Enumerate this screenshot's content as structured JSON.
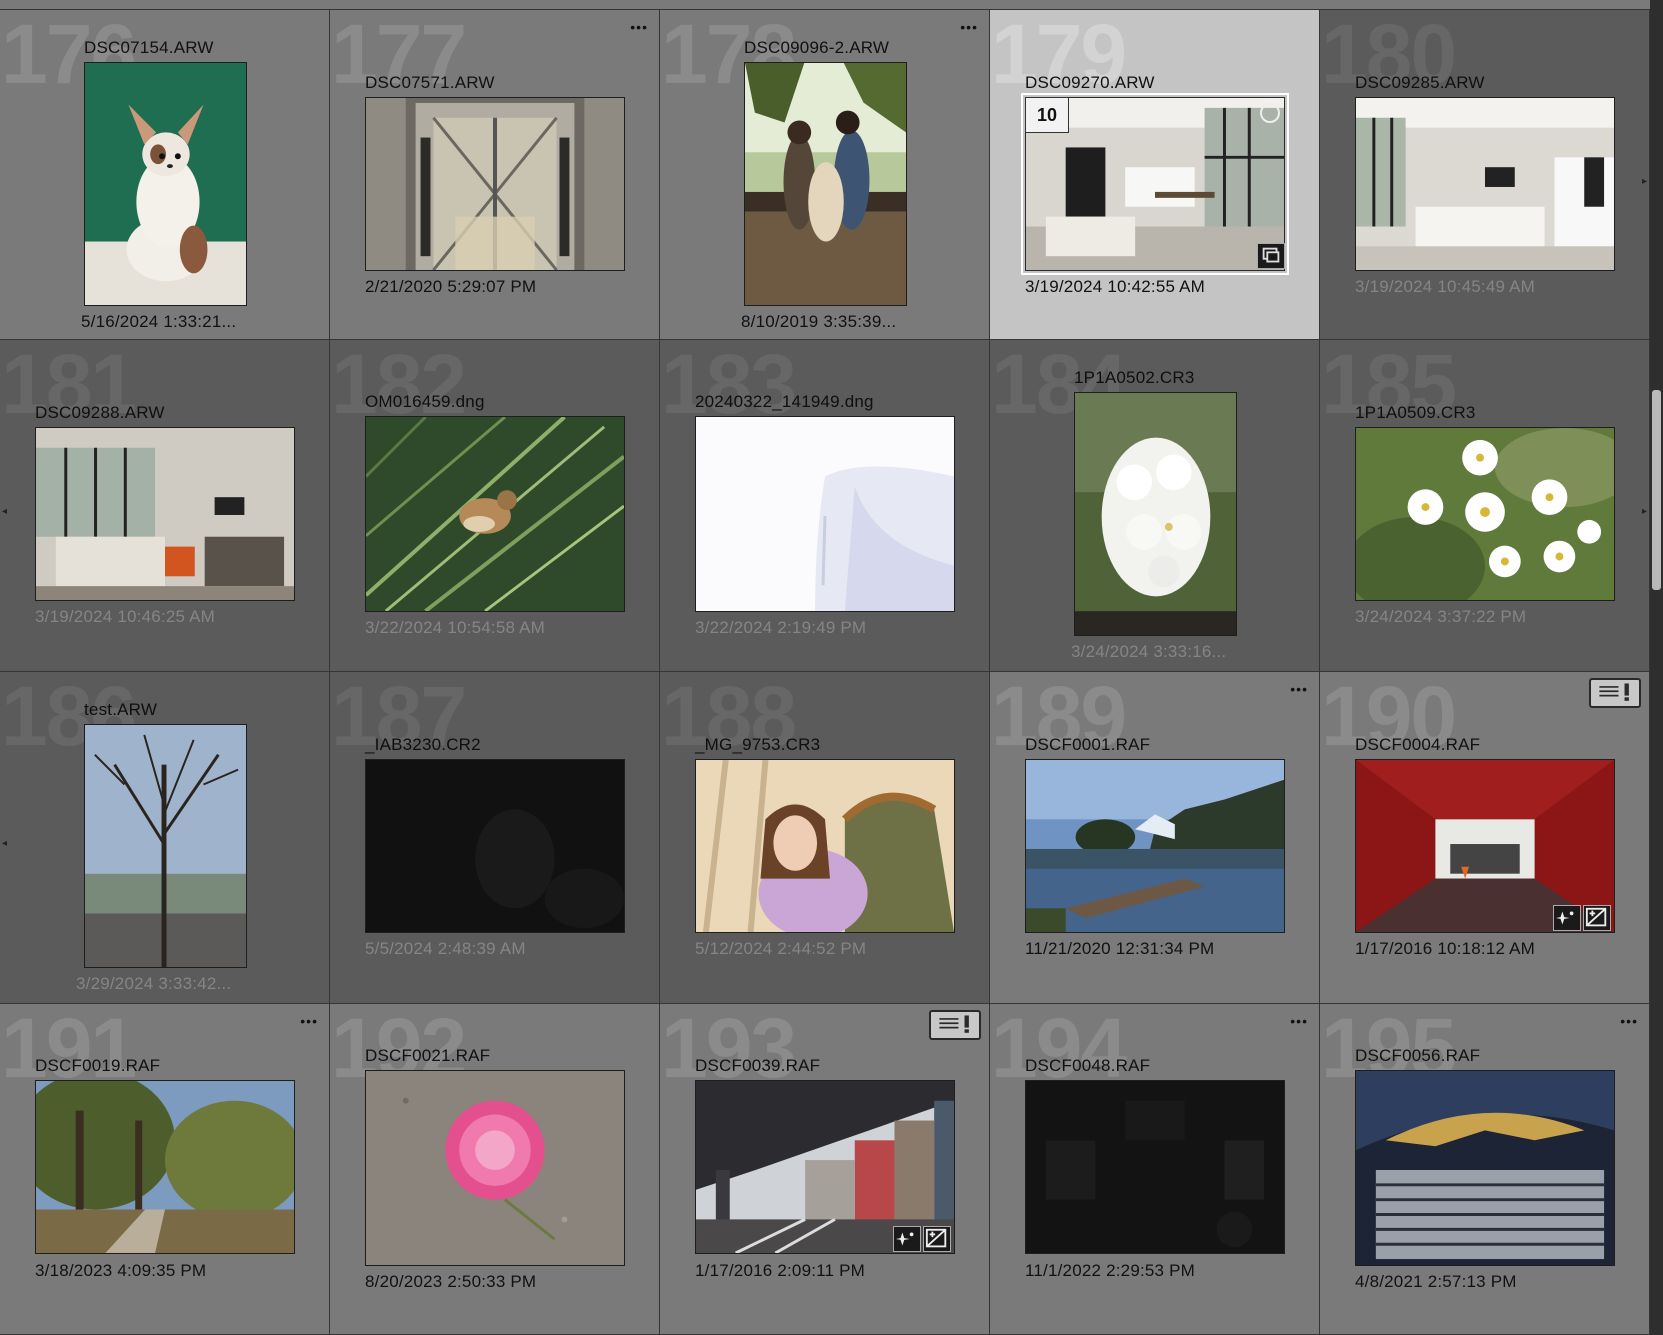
{
  "grid": {
    "cells": [
      {
        "index": "176",
        "filename": "DSC07154.ARW",
        "date": "5/16/2024 1:33:21...",
        "state": "light",
        "orientation": "portrait"
      },
      {
        "index": "177",
        "filename": "DSC07571.ARW",
        "date": "2/21/2020 5:29:07 PM",
        "state": "light",
        "orientation": "landscape",
        "more": "•••"
      },
      {
        "index": "178",
        "filename": "DSC09096-2.ARW",
        "date": "8/10/2019 3:35:39...",
        "state": "light",
        "orientation": "portrait",
        "more": "•••"
      },
      {
        "index": "179",
        "filename": "DSC09270.ARW",
        "date": "3/19/2024 10:42:55 AM",
        "state": "selected",
        "orientation": "landscape",
        "stack_count": "10"
      },
      {
        "index": "180",
        "filename": "DSC09285.ARW",
        "date": "3/19/2024 10:45:49 AM",
        "state": "dark",
        "orientation": "landscape"
      },
      {
        "index": "181",
        "filename": "DSC09288.ARW",
        "date": "3/19/2024 10:46:25 AM",
        "state": "dark",
        "orientation": "landscape"
      },
      {
        "index": "182",
        "filename": "OM016459.dng",
        "date": "3/22/2024 10:54:58 AM",
        "state": "dark",
        "orientation": "landscape"
      },
      {
        "index": "183",
        "filename": "20240322_141949.dng",
        "date": "3/22/2024 2:19:49 PM",
        "state": "dark",
        "orientation": "landscape"
      },
      {
        "index": "184",
        "filename": "1P1A0502.CR3",
        "date": "3/24/2024 3:33:16...",
        "state": "dark",
        "orientation": "portrait"
      },
      {
        "index": "185",
        "filename": "1P1A0509.CR3",
        "date": "3/24/2024 3:37:22 PM",
        "state": "dark",
        "orientation": "landscape"
      },
      {
        "index": "186",
        "filename": "test.ARW",
        "date": "3/29/2024 3:33:42...",
        "state": "dark",
        "orientation": "portrait"
      },
      {
        "index": "187",
        "filename": "_IAB3230.CR2",
        "date": "5/5/2024 2:48:39 AM",
        "state": "dark",
        "orientation": "landscape"
      },
      {
        "index": "188",
        "filename": "_MG_9753.CR3",
        "date": "5/12/2024 2:44:52 PM",
        "state": "dark",
        "orientation": "landscape"
      },
      {
        "index": "189",
        "filename": "DSCF0001.RAF",
        "date": "11/21/2020 12:31:34 PM",
        "state": "light",
        "orientation": "landscape",
        "more": "•••"
      },
      {
        "index": "190",
        "filename": "DSCF0004.RAF",
        "date": "1/17/2016 10:18:12 AM",
        "state": "light",
        "orientation": "landscape",
        "metadata_warning": true,
        "develop_badges": true
      },
      {
        "index": "191",
        "filename": "DSCF0019.RAF",
        "date": "3/18/2023 4:09:35 PM",
        "state": "light",
        "orientation": "landscape",
        "more": "•••"
      },
      {
        "index": "192",
        "filename": "DSCF0021.RAF",
        "date": "8/20/2023 2:50:33 PM",
        "state": "light",
        "orientation": "landscape"
      },
      {
        "index": "193",
        "filename": "DSCF0039.RAF",
        "date": "1/17/2016 2:09:11 PM",
        "state": "light",
        "orientation": "landscape",
        "metadata_warning": true,
        "develop_badges": true
      },
      {
        "index": "194",
        "filename": "DSCF0048.RAF",
        "date": "11/1/2022 2:29:53 PM",
        "state": "light",
        "orientation": "landscape",
        "more": "•••"
      },
      {
        "index": "195",
        "filename": "DSCF0056.RAF",
        "date": "4/8/2021 2:57:13 PM",
        "state": "light",
        "orientation": "landscape",
        "more": "•••"
      }
    ]
  },
  "icons": {
    "more": "more-options-icon",
    "metadata_warning": "metadata-warning-icon",
    "stack": "stack-icon",
    "develop": "develop-settings-icon",
    "select_circle": "selection-circle-icon"
  }
}
